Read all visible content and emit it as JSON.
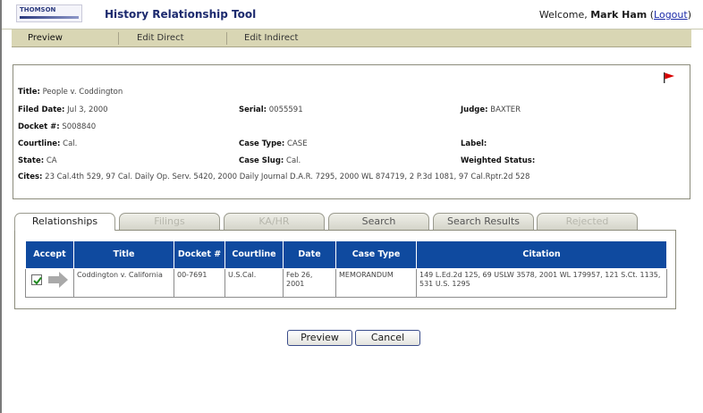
{
  "header": {
    "logo_text": "THOMSON",
    "title": "History Relationship Tool",
    "welcome_prefix": "Welcome, ",
    "user_name": "Mark Ham",
    "logout_open": " (",
    "logout_label": "Logout",
    "logout_close": ")"
  },
  "menu": {
    "items": [
      {
        "label": "Preview"
      },
      {
        "label": "Edit Direct"
      },
      {
        "label": "Edit Indirect"
      }
    ]
  },
  "case": {
    "title_label": "Title:",
    "title_value": "People v. Coddington",
    "filed_label": "Filed Date:",
    "filed_value": "Jul 3, 2000",
    "serial_label": "Serial:",
    "serial_value": "0055591",
    "judge_label": "Judge:",
    "judge_value": "BAXTER",
    "docket_label": "Docket #:",
    "docket_value": "S008840",
    "courtline_label": "Courtline:",
    "courtline_value": "Cal.",
    "casetype_label": "Case Type:",
    "casetype_value": "CASE",
    "label_label": "Label:",
    "label_value": "",
    "state_label": "State:",
    "state_value": "CA",
    "caseslug_label": "Case Slug:",
    "caseslug_value": "Cal.",
    "weighted_label": "Weighted Status:",
    "weighted_value": "",
    "cites_label": "Cites:",
    "cites_value": "23 Cal.4th 529, 97 Cal. Daily Op. Serv. 5420, 2000 Daily Journal D.A.R. 7295, 2000 WL 874719, 2 P.3d 1081, 97 Cal.Rptr.2d 528"
  },
  "tabs": [
    {
      "label": "Relationships"
    },
    {
      "label": "Filings"
    },
    {
      "label": "KA/HR"
    },
    {
      "label": "Search"
    },
    {
      "label": "Search Results"
    },
    {
      "label": "Rejected"
    }
  ],
  "table": {
    "headers": {
      "accept": "Accept",
      "title": "Title",
      "docket": "Docket #",
      "courtline": "Courtline",
      "date": "Date",
      "casetype": "Case Type",
      "citation": "Citation"
    },
    "rows": [
      {
        "title": "Coddington v. California",
        "docket": "00-7691",
        "courtline": "U.S.Cal.",
        "date": "Feb 26, 2001",
        "casetype": "MEMORANDUM",
        "citation": "149 L.Ed.2d 125, 69 USLW 3578, 2001 WL 179957, 121 S.Ct. 1135, 531 U.S. 1295"
      }
    ]
  },
  "buttons": {
    "preview_label": "Preview",
    "cancel_label": "Cancel"
  },
  "colors": {
    "header_blue": "#0f4a9f",
    "menubar": "#d9d6b4",
    "flag": "#d90000",
    "check": "#1f8a1f"
  }
}
